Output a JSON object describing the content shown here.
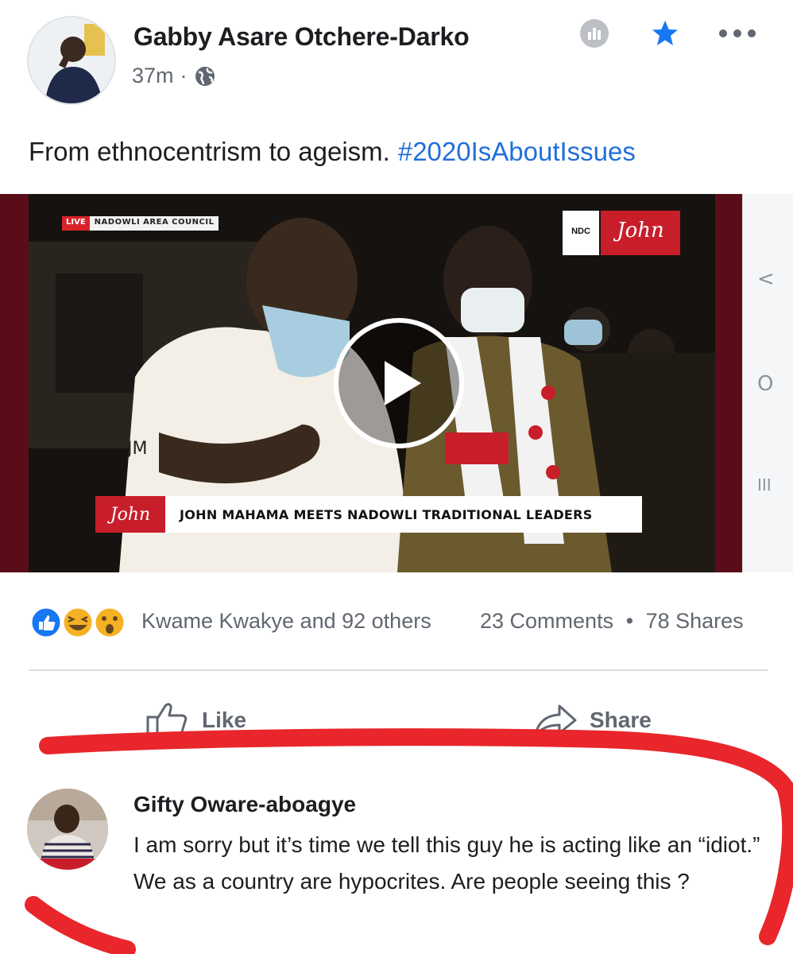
{
  "post": {
    "author": "Gabby Asare Otchere-Darko",
    "time": "37m",
    "separator": "·",
    "text": "From ethnocentrism to ageism.",
    "hashtag": "#2020IsAboutIssues"
  },
  "video": {
    "live_label": "LIVE",
    "council_label": "NADOWLI AREA COUNCIL",
    "ndc_label": "NDC",
    "brand_logo": "John",
    "jacket_text": "JM",
    "banner_logo": "John",
    "banner_text": "JOHN MAHAMA MEETS NADOWLI TRADITIONAL LEADERS",
    "side_controls": [
      "<",
      "O",
      "III"
    ]
  },
  "engagement": {
    "reactions": [
      "like",
      "haha",
      "wow"
    ],
    "reacted_by": "Kwame Kwakye and 92 others",
    "comments": "23 Comments",
    "dot": "•",
    "shares": "78 Shares"
  },
  "actions": {
    "like_label": "Like",
    "share_label": "Share"
  },
  "comment": {
    "author": "Gifty Oware-aboagye",
    "text": "I am sorry but it’s time we tell this guy he is acting like an “idiot.” We as a country are hypocrites. Are people seeing this ?"
  },
  "colors": {
    "link": "#216fdb",
    "meta": "#606770",
    "annotation_red": "#e8262b",
    "brand_red": "#c81e2a"
  }
}
